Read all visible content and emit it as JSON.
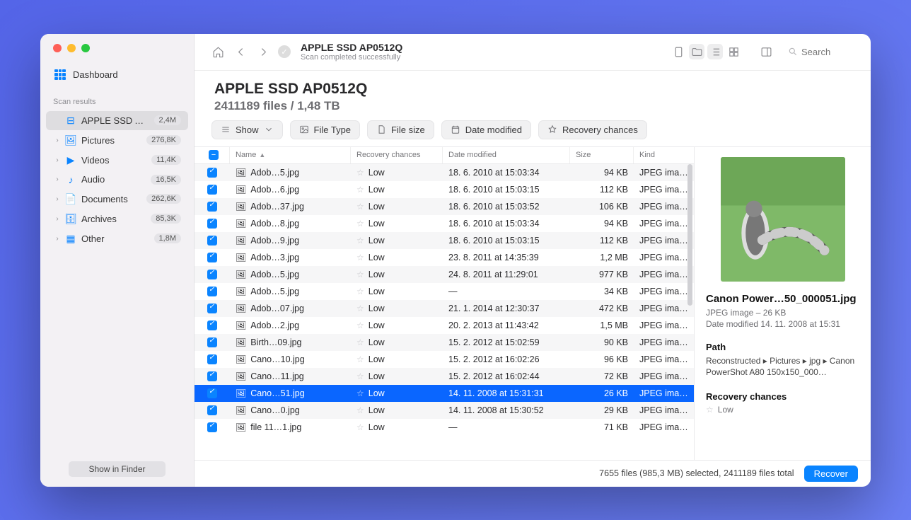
{
  "sidebar": {
    "dashboard": "Dashboard",
    "section": "Scan results",
    "items": [
      {
        "icon": "drive",
        "label": "APPLE SSD AP0…",
        "count": "2,4M",
        "selected": true,
        "expandable": false
      },
      {
        "icon": "image",
        "label": "Pictures",
        "count": "276,8K"
      },
      {
        "icon": "video",
        "label": "Videos",
        "count": "11,4K"
      },
      {
        "icon": "audio",
        "label": "Audio",
        "count": "16,5K"
      },
      {
        "icon": "doc",
        "label": "Documents",
        "count": "262,6K"
      },
      {
        "icon": "archive",
        "label": "Archives",
        "count": "85,3K"
      },
      {
        "icon": "other",
        "label": "Other",
        "count": "1,8M"
      }
    ],
    "footer_btn": "Show in Finder"
  },
  "toolbar": {
    "title": "APPLE SSD AP0512Q",
    "subtitle": "Scan completed successfully",
    "search_placeholder": "Search"
  },
  "page": {
    "title": "APPLE SSD AP0512Q",
    "subtitle": "2411189 files / 1,48 TB"
  },
  "filters": {
    "show": "Show",
    "type": "File Type",
    "size": "File size",
    "date": "Date modified",
    "recovery": "Recovery chances"
  },
  "columns": {
    "name": "Name",
    "recovery": "Recovery chances",
    "date": "Date modified",
    "size": "Size",
    "kind": "Kind"
  },
  "rows": [
    {
      "name": "Adob…5.jpg",
      "rec": "Low",
      "date": "18. 6. 2010 at 15:03:34",
      "size": "94 KB",
      "kind": "JPEG ima…"
    },
    {
      "name": "Adob…6.jpg",
      "rec": "Low",
      "date": "18. 6. 2010 at 15:03:15",
      "size": "112 KB",
      "kind": "JPEG ima…"
    },
    {
      "name": "Adob…37.jpg",
      "rec": "Low",
      "date": "18. 6. 2010 at 15:03:52",
      "size": "106 KB",
      "kind": "JPEG ima…"
    },
    {
      "name": "Adob…8.jpg",
      "rec": "Low",
      "date": "18. 6. 2010 at 15:03:34",
      "size": "94 KB",
      "kind": "JPEG ima…"
    },
    {
      "name": "Adob…9.jpg",
      "rec": "Low",
      "date": "18. 6. 2010 at 15:03:15",
      "size": "112 KB",
      "kind": "JPEG ima…"
    },
    {
      "name": "Adob…3.jpg",
      "rec": "Low",
      "date": "23. 8. 2011 at 14:35:39",
      "size": "1,2 MB",
      "kind": "JPEG ima…"
    },
    {
      "name": "Adob…5.jpg",
      "rec": "Low",
      "date": "24. 8. 2011 at 11:29:01",
      "size": "977 KB",
      "kind": "JPEG ima…"
    },
    {
      "name": "Adob…5.jpg",
      "rec": "Low",
      "date": "—",
      "size": "34 KB",
      "kind": "JPEG ima…"
    },
    {
      "name": "Adob…07.jpg",
      "rec": "Low",
      "date": "21. 1. 2014 at 12:30:37",
      "size": "472 KB",
      "kind": "JPEG ima…"
    },
    {
      "name": "Adob…2.jpg",
      "rec": "Low",
      "date": "20. 2. 2013 at 11:43:42",
      "size": "1,5 MB",
      "kind": "JPEG ima…"
    },
    {
      "name": "Birth…09.jpg",
      "rec": "Low",
      "date": "15. 2. 2012 at 15:02:59",
      "size": "90 KB",
      "kind": "JPEG ima…"
    },
    {
      "name": "Cano…10.jpg",
      "rec": "Low",
      "date": "15. 2. 2012 at 16:02:26",
      "size": "96 KB",
      "kind": "JPEG ima…"
    },
    {
      "name": "Cano…11.jpg",
      "rec": "Low",
      "date": "15. 2. 2012 at 16:02:44",
      "size": "72 KB",
      "kind": "JPEG ima…"
    },
    {
      "name": "Cano…51.jpg",
      "rec": "Low",
      "date": "14. 11. 2008 at 15:31:31",
      "size": "26 KB",
      "kind": "JPEG ima…",
      "selected": true
    },
    {
      "name": "Cano…0.jpg",
      "rec": "Low",
      "date": "14. 11. 2008 at 15:30:52",
      "size": "29 KB",
      "kind": "JPEG ima…"
    },
    {
      "name": "file 11…1.jpg",
      "rec": "Low",
      "date": "—",
      "size": "71 KB",
      "kind": "JPEG ima…"
    }
  ],
  "preview": {
    "name": "Canon Power…50_000051.jpg",
    "meta": "JPEG image – 26 KB",
    "date_label": "Date modified",
    "date": "14. 11. 2008 at 15:31",
    "path_hdr": "Path",
    "path": "Reconstructed ▸ Pictures ▸ jpg ▸ Canon PowerShot A80 150x150_000…",
    "rec_hdr": "Recovery chances",
    "rec": "Low"
  },
  "footer": {
    "summary": "7655 files (985,3 MB) selected, 2411189 files total",
    "recover": "Recover"
  }
}
